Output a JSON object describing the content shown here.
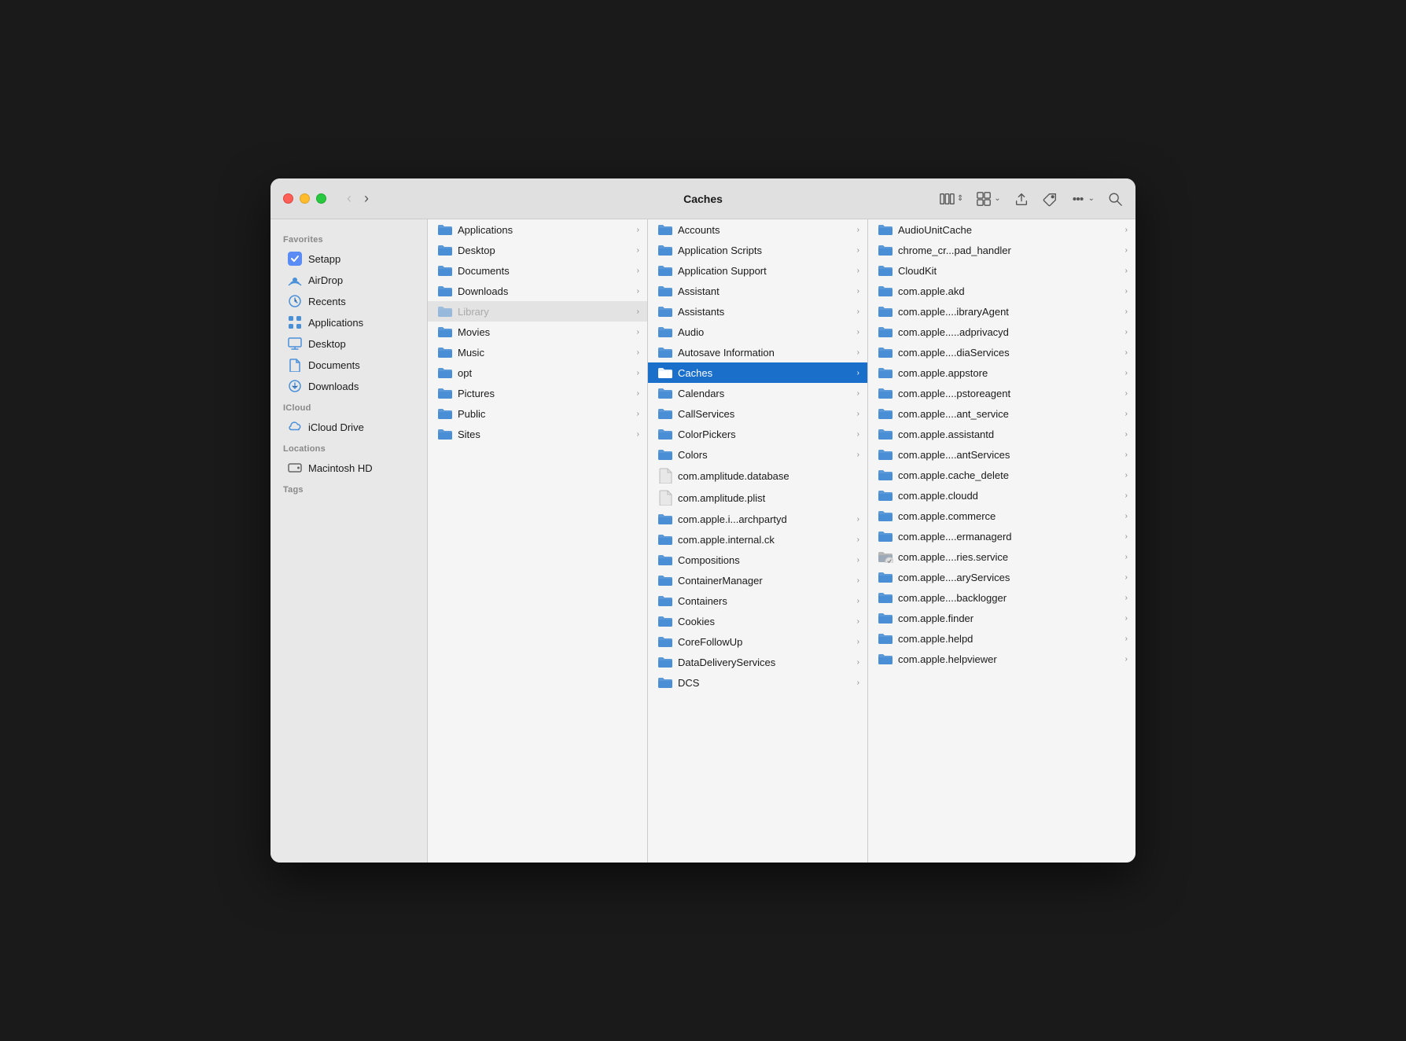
{
  "window": {
    "title": "Caches"
  },
  "toolbar": {
    "back_label": "‹",
    "forward_label": "›",
    "view_icon": "columns-view",
    "grid_icon": "grid-view",
    "share_icon": "share",
    "tag_icon": "tag",
    "more_icon": "more",
    "search_icon": "search"
  },
  "sidebar": {
    "favorites_label": "Favorites",
    "icloud_label": "iCloud",
    "locations_label": "Locations",
    "tags_label": "Tags",
    "items": [
      {
        "id": "setapp",
        "label": "Setapp",
        "icon": "setapp"
      },
      {
        "id": "airdrop",
        "label": "AirDrop",
        "icon": "airdrop"
      },
      {
        "id": "recents",
        "label": "Recents",
        "icon": "recents"
      },
      {
        "id": "applications",
        "label": "Applications",
        "icon": "applications"
      },
      {
        "id": "desktop",
        "label": "Desktop",
        "icon": "desktop"
      },
      {
        "id": "documents",
        "label": "Documents",
        "icon": "documents"
      },
      {
        "id": "downloads",
        "label": "Downloads",
        "icon": "downloads"
      },
      {
        "id": "icloud-drive",
        "label": "iCloud Drive",
        "icon": "icloud"
      },
      {
        "id": "macintosh-hd",
        "label": "Macintosh HD",
        "icon": "disk"
      }
    ]
  },
  "col1": {
    "items": [
      {
        "id": "applications",
        "label": "Applications",
        "type": "folder",
        "has_arrow": true
      },
      {
        "id": "desktop",
        "label": "Desktop",
        "type": "folder",
        "has_arrow": true
      },
      {
        "id": "documents",
        "label": "Documents",
        "type": "folder",
        "has_arrow": true
      },
      {
        "id": "downloads",
        "label": "Downloads",
        "type": "folder",
        "has_arrow": true
      },
      {
        "id": "library",
        "label": "Library",
        "type": "folder",
        "has_arrow": true,
        "selected": true,
        "dimmed": false
      },
      {
        "id": "movies",
        "label": "Movies",
        "type": "folder",
        "has_arrow": true
      },
      {
        "id": "music",
        "label": "Music",
        "type": "folder",
        "has_arrow": true
      },
      {
        "id": "opt",
        "label": "opt",
        "type": "folder",
        "has_arrow": true
      },
      {
        "id": "pictures",
        "label": "Pictures",
        "type": "folder",
        "has_arrow": true
      },
      {
        "id": "public",
        "label": "Public",
        "type": "folder",
        "has_arrow": true
      },
      {
        "id": "sites",
        "label": "Sites",
        "type": "folder",
        "has_arrow": true
      }
    ]
  },
  "col2": {
    "items": [
      {
        "id": "accounts",
        "label": "Accounts",
        "type": "folder",
        "has_arrow": true
      },
      {
        "id": "application-scripts",
        "label": "Application Scripts",
        "type": "folder",
        "has_arrow": true
      },
      {
        "id": "application-support",
        "label": "Application Support",
        "type": "folder",
        "has_arrow": true
      },
      {
        "id": "assistant",
        "label": "Assistant",
        "type": "folder",
        "has_arrow": true
      },
      {
        "id": "assistants",
        "label": "Assistants",
        "type": "folder",
        "has_arrow": true
      },
      {
        "id": "audio",
        "label": "Audio",
        "type": "folder",
        "has_arrow": true
      },
      {
        "id": "autosave-information",
        "label": "Autosave Information",
        "type": "folder",
        "has_arrow": true
      },
      {
        "id": "caches",
        "label": "Caches",
        "type": "folder",
        "has_arrow": true,
        "selected": true
      },
      {
        "id": "calendars",
        "label": "Calendars",
        "type": "folder",
        "has_arrow": true
      },
      {
        "id": "callservices",
        "label": "CallServices",
        "type": "folder",
        "has_arrow": true
      },
      {
        "id": "colorpickers",
        "label": "ColorPickers",
        "type": "folder",
        "has_arrow": true
      },
      {
        "id": "colors",
        "label": "Colors",
        "type": "folder",
        "has_arrow": true
      },
      {
        "id": "com-amplitude-database",
        "label": "com.amplitude.database",
        "type": "file",
        "has_arrow": false
      },
      {
        "id": "com-amplitude-plist",
        "label": "com.amplitude.plist",
        "type": "file",
        "has_arrow": false
      },
      {
        "id": "com-apple-iarchpartyd",
        "label": "com.apple.i...archpartyd",
        "type": "folder",
        "has_arrow": true
      },
      {
        "id": "com-apple-internal-ck",
        "label": "com.apple.internal.ck",
        "type": "folder",
        "has_arrow": true
      },
      {
        "id": "compositions",
        "label": "Compositions",
        "type": "folder",
        "has_arrow": true
      },
      {
        "id": "containermanager",
        "label": "ContainerManager",
        "type": "folder",
        "has_arrow": true
      },
      {
        "id": "containers",
        "label": "Containers",
        "type": "folder",
        "has_arrow": true
      },
      {
        "id": "cookies",
        "label": "Cookies",
        "type": "folder",
        "has_arrow": true
      },
      {
        "id": "corefollowup",
        "label": "CoreFollowUp",
        "type": "folder",
        "has_arrow": true
      },
      {
        "id": "datadeliveryservices",
        "label": "DataDeliveryServices",
        "type": "folder",
        "has_arrow": true
      },
      {
        "id": "dcs",
        "label": "DCS",
        "type": "folder",
        "has_arrow": true
      }
    ]
  },
  "col3": {
    "items": [
      {
        "id": "audiounitcache",
        "label": "AudioUnitCache",
        "type": "folder",
        "has_arrow": true
      },
      {
        "id": "chrome-pad-handler",
        "label": "chrome_cr...pad_handler",
        "type": "folder",
        "has_arrow": true
      },
      {
        "id": "cloudkit",
        "label": "CloudKit",
        "type": "folder",
        "has_arrow": true
      },
      {
        "id": "com-apple-akd",
        "label": "com.apple.akd",
        "type": "folder",
        "has_arrow": true
      },
      {
        "id": "com-apple-ibraryagent",
        "label": "com.apple....ibraryAgent",
        "type": "folder",
        "has_arrow": true
      },
      {
        "id": "com-apple-adprivacyd",
        "label": "com.apple.....adprivacyd",
        "type": "folder",
        "has_arrow": true
      },
      {
        "id": "com-apple-diaservices",
        "label": "com.apple....diaServices",
        "type": "folder",
        "has_arrow": true
      },
      {
        "id": "com-apple-appstore",
        "label": "com.apple.appstore",
        "type": "folder",
        "has_arrow": true
      },
      {
        "id": "com-apple-pstoreagent",
        "label": "com.apple....pstoreagent",
        "type": "folder",
        "has_arrow": true
      },
      {
        "id": "com-apple-ant-service",
        "label": "com.apple....ant_service",
        "type": "folder",
        "has_arrow": true
      },
      {
        "id": "com-apple-assistantd",
        "label": "com.apple.assistantd",
        "type": "folder",
        "has_arrow": true
      },
      {
        "id": "com-apple-antservices",
        "label": "com.apple....antServices",
        "type": "folder",
        "has_arrow": true
      },
      {
        "id": "com-apple-cache-delete",
        "label": "com.apple.cache_delete",
        "type": "folder",
        "has_arrow": true
      },
      {
        "id": "com-apple-cloudd",
        "label": "com.apple.cloudd",
        "type": "folder",
        "has_arrow": true
      },
      {
        "id": "com-apple-commerce",
        "label": "com.apple.commerce",
        "type": "folder",
        "has_arrow": true
      },
      {
        "id": "com-apple-ermanagerd",
        "label": "com.apple....ermanagerd",
        "type": "folder",
        "has_arrow": true
      },
      {
        "id": "com-apple-ries-service",
        "label": "com.apple....ries.service",
        "type": "folder",
        "has_arrow": true,
        "special_icon": true
      },
      {
        "id": "com-apple-aryservices",
        "label": "com.apple....aryServices",
        "type": "folder",
        "has_arrow": true
      },
      {
        "id": "com-apple-backlogger",
        "label": "com.apple....backlogger",
        "type": "folder",
        "has_arrow": true
      },
      {
        "id": "com-apple-finder",
        "label": "com.apple.finder",
        "type": "folder",
        "has_arrow": true
      },
      {
        "id": "com-apple-helpd",
        "label": "com.apple.helpd",
        "type": "folder",
        "has_arrow": true
      },
      {
        "id": "com-apple-helpviewer",
        "label": "com.apple.helpviewer",
        "type": "folder",
        "has_arrow": true
      }
    ]
  }
}
